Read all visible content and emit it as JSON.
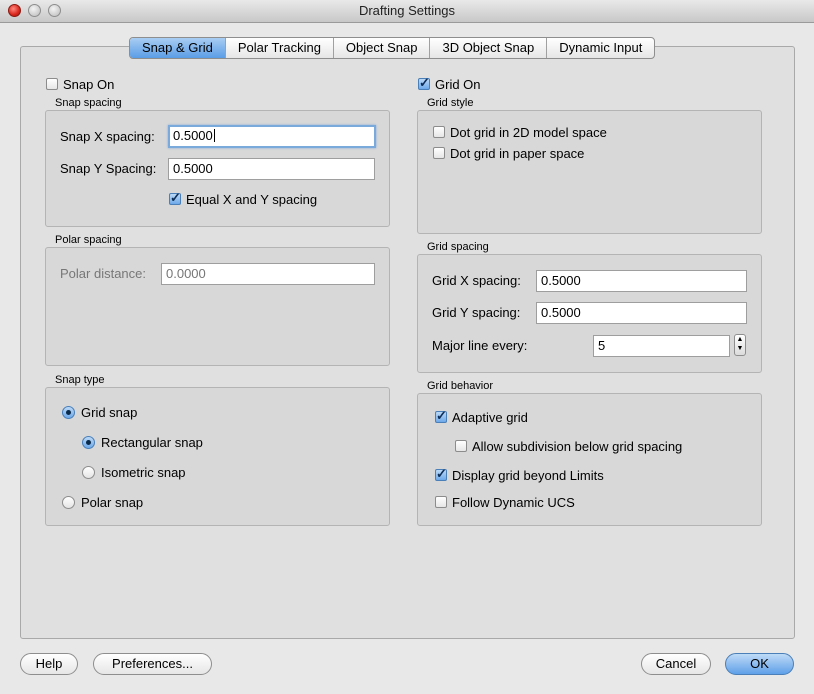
{
  "window": {
    "title": "Drafting Settings"
  },
  "tabs": [
    {
      "label": "Snap & Grid",
      "active": true
    },
    {
      "label": "Polar Tracking"
    },
    {
      "label": "Object Snap"
    },
    {
      "label": "3D Object Snap"
    },
    {
      "label": "Dynamic Input"
    }
  ],
  "snap": {
    "snap_on": {
      "label": "Snap On",
      "checked": false
    },
    "spacing_group": "Snap spacing",
    "x_label": "Snap X spacing:",
    "x_value": "0.5000",
    "y_label": "Snap Y Spacing:",
    "y_value": "0.5000",
    "equal": {
      "label": "Equal X and Y spacing",
      "checked": true
    }
  },
  "polar": {
    "group": "Polar spacing",
    "distance_label": "Polar distance:",
    "distance_value": "0.0000"
  },
  "snap_type": {
    "group": "Snap type",
    "grid_snap": "Grid snap",
    "rectangular": "Rectangular snap",
    "isometric": "Isometric snap",
    "polar_snap": "Polar snap"
  },
  "grid": {
    "grid_on": {
      "label": "Grid On",
      "checked": true
    },
    "style_group": "Grid style",
    "dot_model": "Dot grid in 2D model space",
    "dot_paper": "Dot grid in paper space",
    "spacing_group": "Grid spacing",
    "x_label": "Grid X spacing:",
    "x_value": "0.5000",
    "y_label": "Grid Y spacing:",
    "y_value": "0.5000",
    "major_label": "Major line every:",
    "major_value": "5",
    "behavior_group": "Grid behavior",
    "adaptive": "Adaptive grid",
    "subdivision": "Allow subdivision below grid spacing",
    "beyond_limits": "Display grid beyond Limits",
    "follow_ucs": "Follow Dynamic UCS"
  },
  "buttons": {
    "help": "Help",
    "preferences": "Preferences...",
    "cancel": "Cancel",
    "ok": "OK"
  },
  "colors": {
    "accent": "#5fa0e8",
    "focus_ring": "#7aa9dc"
  }
}
